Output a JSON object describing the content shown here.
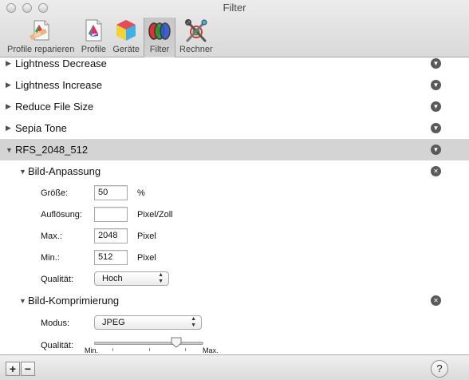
{
  "window": {
    "title": "Filter"
  },
  "toolbar": {
    "items": [
      {
        "label": "Profile reparieren",
        "icon": "profile-repair-icon"
      },
      {
        "label": "Profile",
        "icon": "profile-icon"
      },
      {
        "label": "Geräte",
        "icon": "devices-cube-icon"
      },
      {
        "label": "Filter",
        "icon": "filter-icon",
        "selected": true
      },
      {
        "label": "Rechner",
        "icon": "calculator-tools-icon"
      }
    ]
  },
  "list": {
    "filters": [
      {
        "label": "Lightness Decrease",
        "expanded": false
      },
      {
        "label": "Lightness Increase",
        "expanded": false
      },
      {
        "label": "Reduce File Size",
        "expanded": false
      },
      {
        "label": "Sepia Tone",
        "expanded": false
      },
      {
        "label": "RFS_2048_512",
        "expanded": true,
        "selected": true
      }
    ],
    "expanded_filter": {
      "sections": [
        {
          "label": "Bild-Anpassung",
          "fields": {
            "size": {
              "label": "Größe:",
              "value": "50",
              "unit": "%"
            },
            "resolution": {
              "label": "Auflösung:",
              "value": "",
              "unit": "Pixel/Zoll"
            },
            "max": {
              "label": "Max.:",
              "value": "2048",
              "unit": "Pixel"
            },
            "min": {
              "label": "Min.:",
              "value": "512",
              "unit": "Pixel"
            },
            "quality": {
              "label": "Qualität:",
              "value": "Hoch"
            }
          }
        },
        {
          "label": "Bild-Komprimierung",
          "fields": {
            "mode": {
              "label": "Modus:",
              "value": "JPEG"
            },
            "quality": {
              "label": "Qualität:",
              "min_label": "Min.",
              "max_label": "Max.",
              "level": 0.78
            }
          }
        }
      ]
    }
  },
  "bottombar": {
    "add": "+",
    "remove": "−",
    "help": "?"
  },
  "colors": {
    "selected_row": "#d4d4d4",
    "circle_button": "#5a5a5a"
  }
}
